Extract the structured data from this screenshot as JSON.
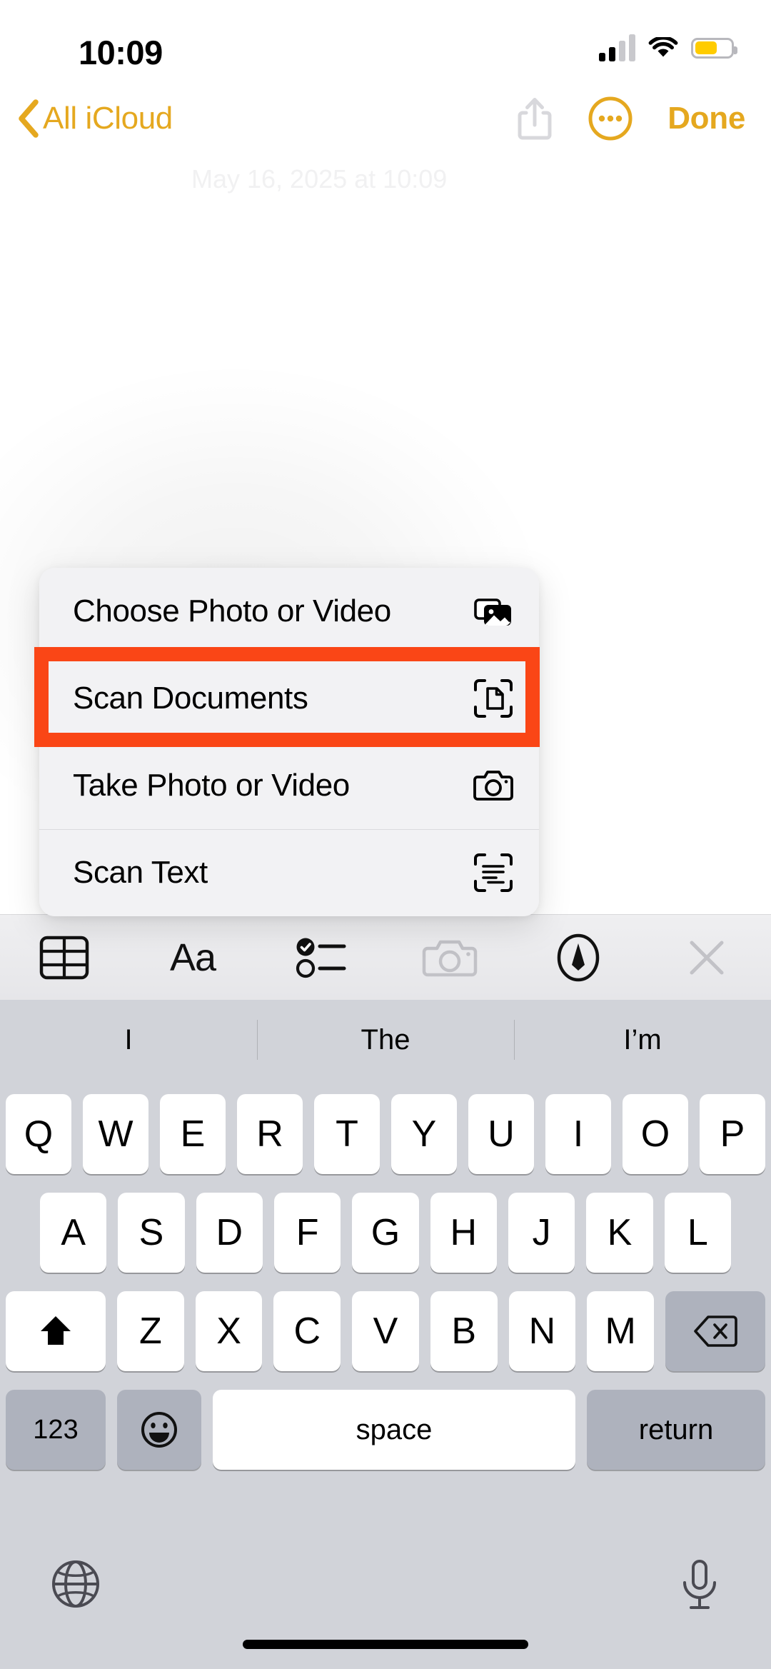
{
  "status_bar": {
    "time": "10:09",
    "signal_icon": "cellular-signal-icon",
    "wifi_icon": "wifi-icon",
    "battery_icon": "battery-icon",
    "battery_level_percent": 62,
    "battery_color": "#FFCC00"
  },
  "nav_bar": {
    "back_label": "All iCloud",
    "back_chevron_icon": "chevron-left-icon",
    "share_icon": "share-icon",
    "more_icon": "more-circle-icon",
    "done_label": "Done",
    "accent_color": "#E5A81F",
    "share_icon_color": "#D8D8DC"
  },
  "note": {
    "date_text": "May 16, 2025 at 10:09"
  },
  "action_menu": {
    "items": [
      {
        "label": "Choose Photo or Video",
        "icon": "photo-stack-icon"
      },
      {
        "label": "Scan Documents",
        "icon": "scan-document-icon",
        "highlighted": true
      },
      {
        "label": "Take Photo or Video",
        "icon": "camera-icon"
      },
      {
        "label": "Scan Text",
        "icon": "scan-text-icon"
      }
    ],
    "highlight_color": "#FA4616",
    "background_color": "#F2F2F4"
  },
  "keyboard_toolbar": {
    "buttons": [
      {
        "name": "table-icon",
        "label": ""
      },
      {
        "name": "text-format-icon",
        "label": "Aa"
      },
      {
        "name": "checklist-icon",
        "label": ""
      },
      {
        "name": "camera-icon",
        "label": "",
        "dimmed": true
      },
      {
        "name": "markup-pen-icon",
        "label": ""
      },
      {
        "name": "close-icon",
        "label": "",
        "dimmed": true
      }
    ]
  },
  "predictive_bar": {
    "suggestions": [
      "I",
      "The",
      "I’m"
    ]
  },
  "keyboard": {
    "row1": [
      "Q",
      "W",
      "E",
      "R",
      "T",
      "Y",
      "U",
      "I",
      "O",
      "P"
    ],
    "row2": [
      "A",
      "S",
      "D",
      "F",
      "G",
      "H",
      "J",
      "K",
      "L"
    ],
    "row3_letters": [
      "Z",
      "X",
      "C",
      "V",
      "B",
      "N",
      "M"
    ],
    "shift_icon": "shift-icon",
    "delete_icon": "delete-backward-icon",
    "numbers_label": "123",
    "emoji_icon": "emoji-icon",
    "space_label": "space",
    "return_label": "return",
    "globe_icon": "globe-icon",
    "mic_icon": "microphone-icon",
    "key_background": "#FFFFFF",
    "keyboard_background": "#D1D3D9"
  }
}
